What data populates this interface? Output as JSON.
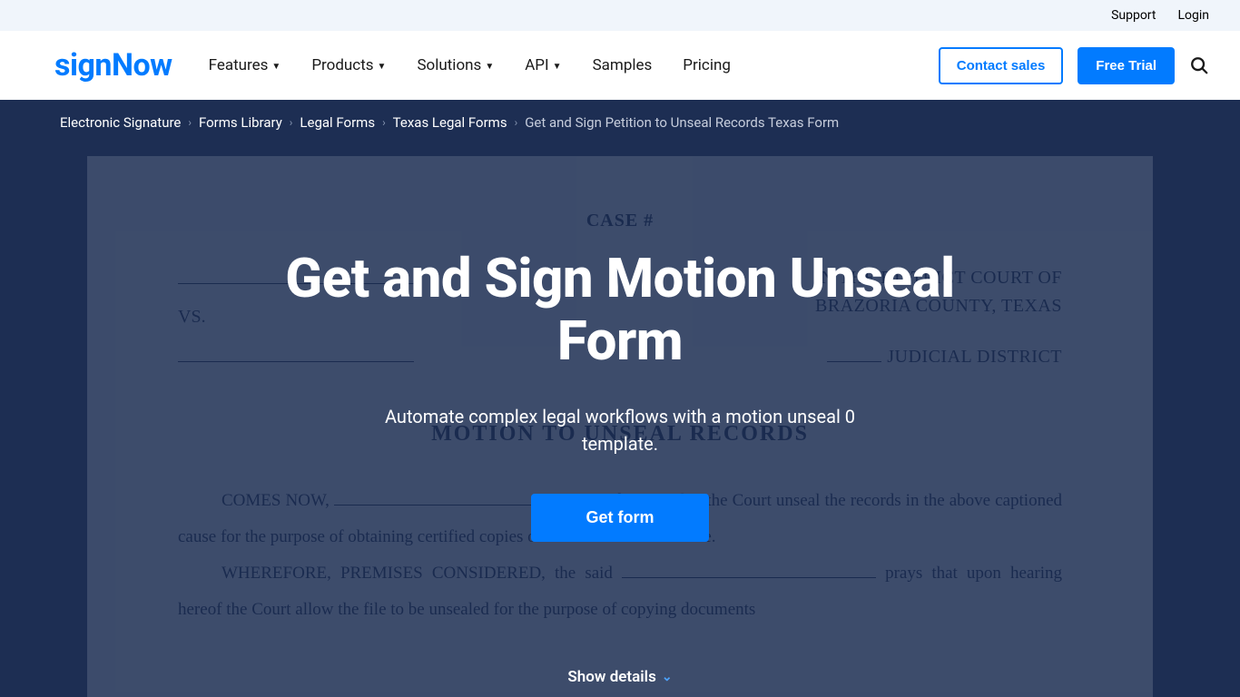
{
  "topbar": {
    "support": "Support",
    "login": "Login"
  },
  "brand": {
    "sign": "sign",
    "now": "Now"
  },
  "nav": {
    "features": "Features",
    "products": "Products",
    "solutions": "Solutions",
    "api": "API",
    "samples": "Samples",
    "pricing": "Pricing"
  },
  "header_actions": {
    "contact_sales": "Contact sales",
    "free_trial": "Free Trial"
  },
  "breadcrumbs": {
    "items": [
      "Electronic Signature",
      "Forms Library",
      "Legal Forms",
      "Texas Legal Forms"
    ],
    "current": "Get and Sign Petition to Unseal Records Texas Form"
  },
  "hero": {
    "title": "Get and Sign Motion Unseal Form",
    "subtitle": "Automate complex legal workflows with a motion unseal 0 template.",
    "cta": "Get form",
    "show_details": "Show details"
  },
  "doc": {
    "case_label": "CASE #",
    "right1": "IN THE DISTRICT COURT OF",
    "vs": "VS.",
    "right2": "BRAZORIA COUNTY, TEXAS",
    "right3_suffix": "JUDICIAL DISTRICT",
    "title": "MOTION TO UNSEAL RECORDS",
    "p1_a": "COMES NOW, ",
    "p1_b": ", and moves that the Court unseal the records in the above captioned cause for the purpose of obtaining certified copies of documents from the file.",
    "p2_a": "WHEREFORE, PREMISES CONSIDERED, the said ",
    "p2_b": " prays that upon hearing hereof the Court allow the file to be unsealed for the purpose of copying documents"
  }
}
